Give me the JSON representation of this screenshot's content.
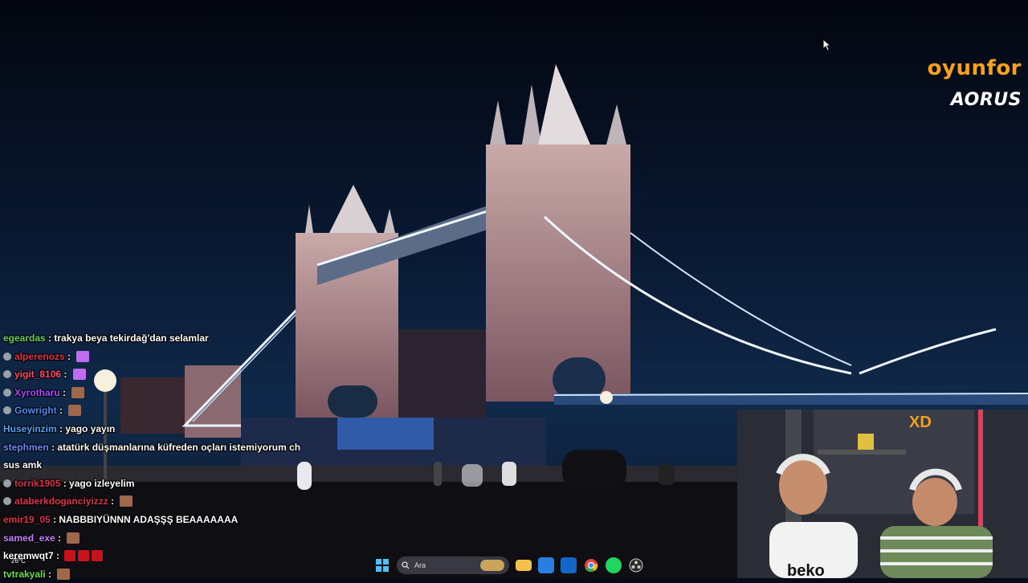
{
  "overlay": {
    "brand_primary": "oyunfor",
    "brand_secondary": "AORUS",
    "brand_color": "#f7a21b"
  },
  "chat": {
    "messages": [
      {
        "user": "egeardas",
        "color": "#5fd35f",
        "text": "trakya beya tekirdağ'dan selamlar",
        "badge": false,
        "emotes": []
      },
      {
        "user": "alperenozs",
        "color": "#e0304a",
        "text": "",
        "badge": true,
        "emotes": [
          "purple"
        ]
      },
      {
        "user": "yigit_8106",
        "color": "#ff4b6e",
        "text": "",
        "badge": true,
        "emotes": [
          "purple"
        ]
      },
      {
        "user": "Xyrotharu",
        "color": "#a54dff",
        "text": "",
        "badge": true,
        "emotes": [
          "face"
        ]
      },
      {
        "user": "Gowright",
        "color": "#4a8dff",
        "text": "",
        "badge": true,
        "emotes": [
          "face"
        ]
      },
      {
        "user": "Huseyinzim",
        "color": "#4aa6ff",
        "text": "yago yayın",
        "badge": false,
        "emotes": []
      },
      {
        "user": "stephmen",
        "color": "#6a8bff",
        "text": "atatürk düşmanlarına küfreden oçları istemiyorum ch",
        "badge": false,
        "emotes": []
      },
      {
        "user": "",
        "color": "#ffffff",
        "text": "sus amk",
        "badge": false,
        "emotes": []
      },
      {
        "user": "torrik1905",
        "color": "#e0304a",
        "text": "yago izleyelim",
        "badge": true,
        "emotes": []
      },
      {
        "user": "ataberkdoganciyizzz",
        "color": "#e0304a",
        "text": "",
        "badge": true,
        "emotes": [
          "face"
        ]
      },
      {
        "user": "emir19_05",
        "color": "#e0304a",
        "text": "NABBBIYÜNNN ADAŞŞŞ BEAAAAAAA",
        "badge": false,
        "emotes": []
      },
      {
        "user": "samed_exe",
        "color": "#c97cff",
        "text": "",
        "badge": false,
        "emotes": [
          "face"
        ]
      },
      {
        "user": "keremwqt7",
        "color": "#ffffff",
        "text": "",
        "badge": false,
        "emotes": [
          "red",
          "red",
          "red"
        ]
      },
      {
        "user": "tvtrakyali",
        "color": "#6adf4a",
        "text": "",
        "badge": false,
        "emotes": [
          "face"
        ]
      }
    ]
  },
  "taskbar": {
    "weather_temp": "26°C",
    "search_placeholder": "Ara",
    "icons": [
      "windows-start-icon",
      "search-icon",
      "file-explorer-icon",
      "store-icon",
      "mail-icon",
      "chrome-icon",
      "spotify-icon",
      "obs-icon"
    ]
  },
  "webcam": {
    "jersey_text": "beko",
    "sign_text": "XD"
  }
}
